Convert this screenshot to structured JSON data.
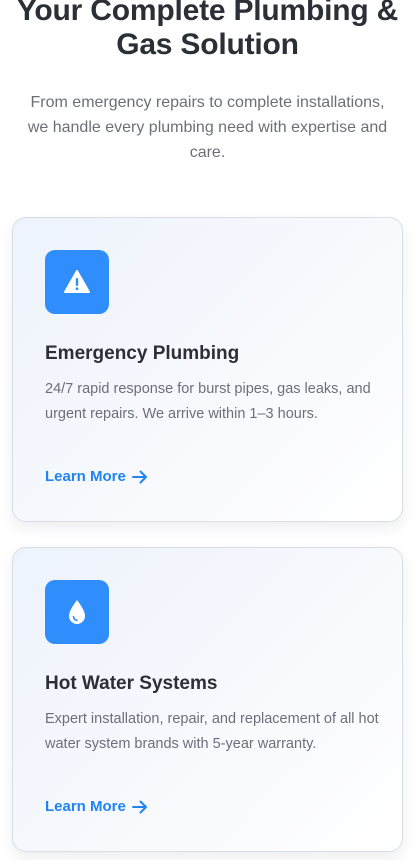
{
  "hero": {
    "title_line1": "Your Complete Plumbing &",
    "title_line2": "Gas Solution",
    "subtitle": "From emergency repairs to complete installations, we handle every plumbing need with expertise and care."
  },
  "services": [
    {
      "icon": "warning-icon",
      "title": "Emergency Plumbing",
      "description": "24/7 rapid response for burst pipes, gas leaks, and urgent repairs. We arrive within 1–3 hours.",
      "link_label": "Learn More"
    },
    {
      "icon": "water-drop-icon",
      "title": "Hot Water Systems",
      "description": "Expert installation, repair, and replacement of all hot water system brands with 5-year warranty.",
      "link_label": "Learn More"
    }
  ],
  "colors": {
    "accent": "#2f8efc",
    "link": "#1f84f2",
    "heading": "#2b2f36",
    "body_text": "#6b7078"
  }
}
